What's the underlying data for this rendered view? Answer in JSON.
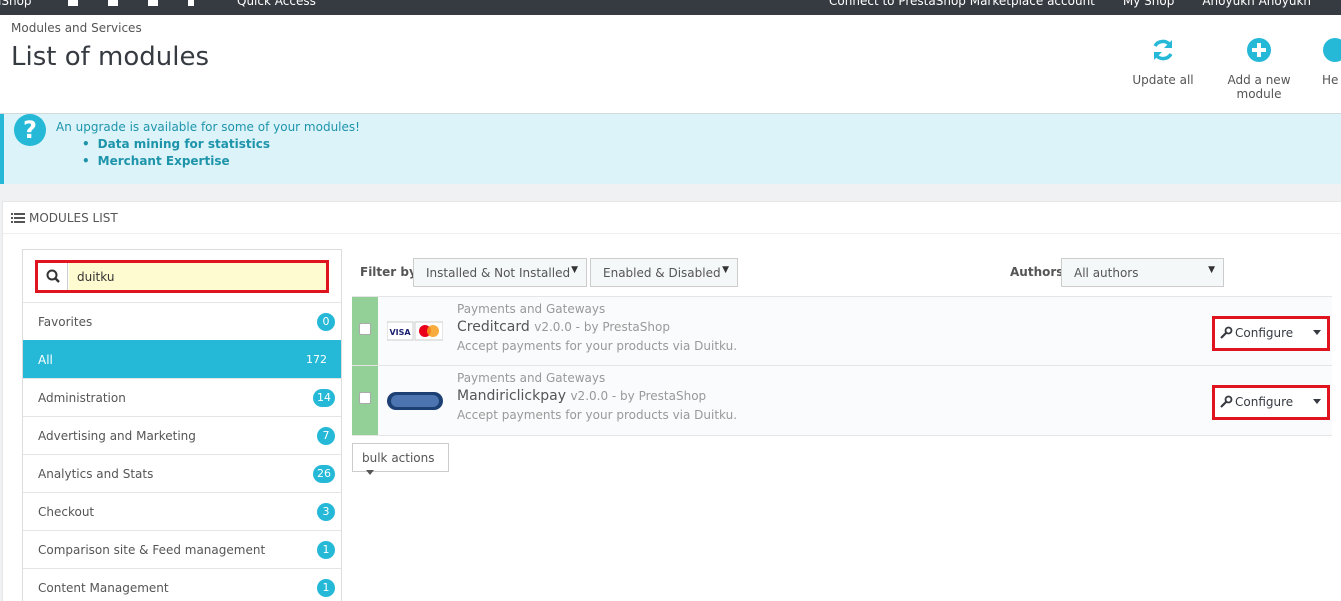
{
  "topbar": {
    "brand": "aShop",
    "quick_access": "Quick Access",
    "right_items": [
      "Connect to PrestaShop Marketplace account",
      "My Shop",
      "Anoyukh Anoyukh"
    ]
  },
  "header": {
    "breadcrumb": "Modules and Services",
    "title": "List of modules",
    "toolbar": {
      "update_all": "Update all",
      "add_module": "Add a new module",
      "help": "He"
    }
  },
  "alert": {
    "message": "An upgrade is available for some of your modules!",
    "items": [
      "Data mining for statistics",
      "Merchant Expertise"
    ]
  },
  "panel": {
    "heading": "MODULES LIST"
  },
  "search": {
    "value": "duitku"
  },
  "categories": [
    {
      "label": "Favorites",
      "count": "0"
    },
    {
      "label": "All",
      "count": "172"
    },
    {
      "label": "Administration",
      "count": "14"
    },
    {
      "label": "Advertising and Marketing",
      "count": "7"
    },
    {
      "label": "Analytics and Stats",
      "count": "26"
    },
    {
      "label": "Checkout",
      "count": "3"
    },
    {
      "label": "Comparison site & Feed management",
      "count": "1"
    },
    {
      "label": "Content Management",
      "count": "1"
    }
  ],
  "filters": {
    "filter_by_label": "Filter by",
    "install_filter": "Installed & Not Installed",
    "enable_filter": "Enabled & Disabled",
    "authors_label": "Authors",
    "authors_filter": "All authors"
  },
  "modules": [
    {
      "category": "Payments and Gateways",
      "name": "Creditcard",
      "version": "v2.0.0 - by PrestaShop",
      "description": "Accept payments for your products via Duitku.",
      "action": "Configure"
    },
    {
      "category": "Payments and Gateways",
      "name": "Mandiriclickpay",
      "version": "v2.0.0 - by PrestaShop",
      "description": "Accept payments for your products via Duitku.",
      "action": "Configure"
    }
  ],
  "bulk_actions": "bulk actions",
  "colors": {
    "accent": "#25b9d7",
    "highlight_box": "#e0141e",
    "enabled_status": "#92d097"
  }
}
